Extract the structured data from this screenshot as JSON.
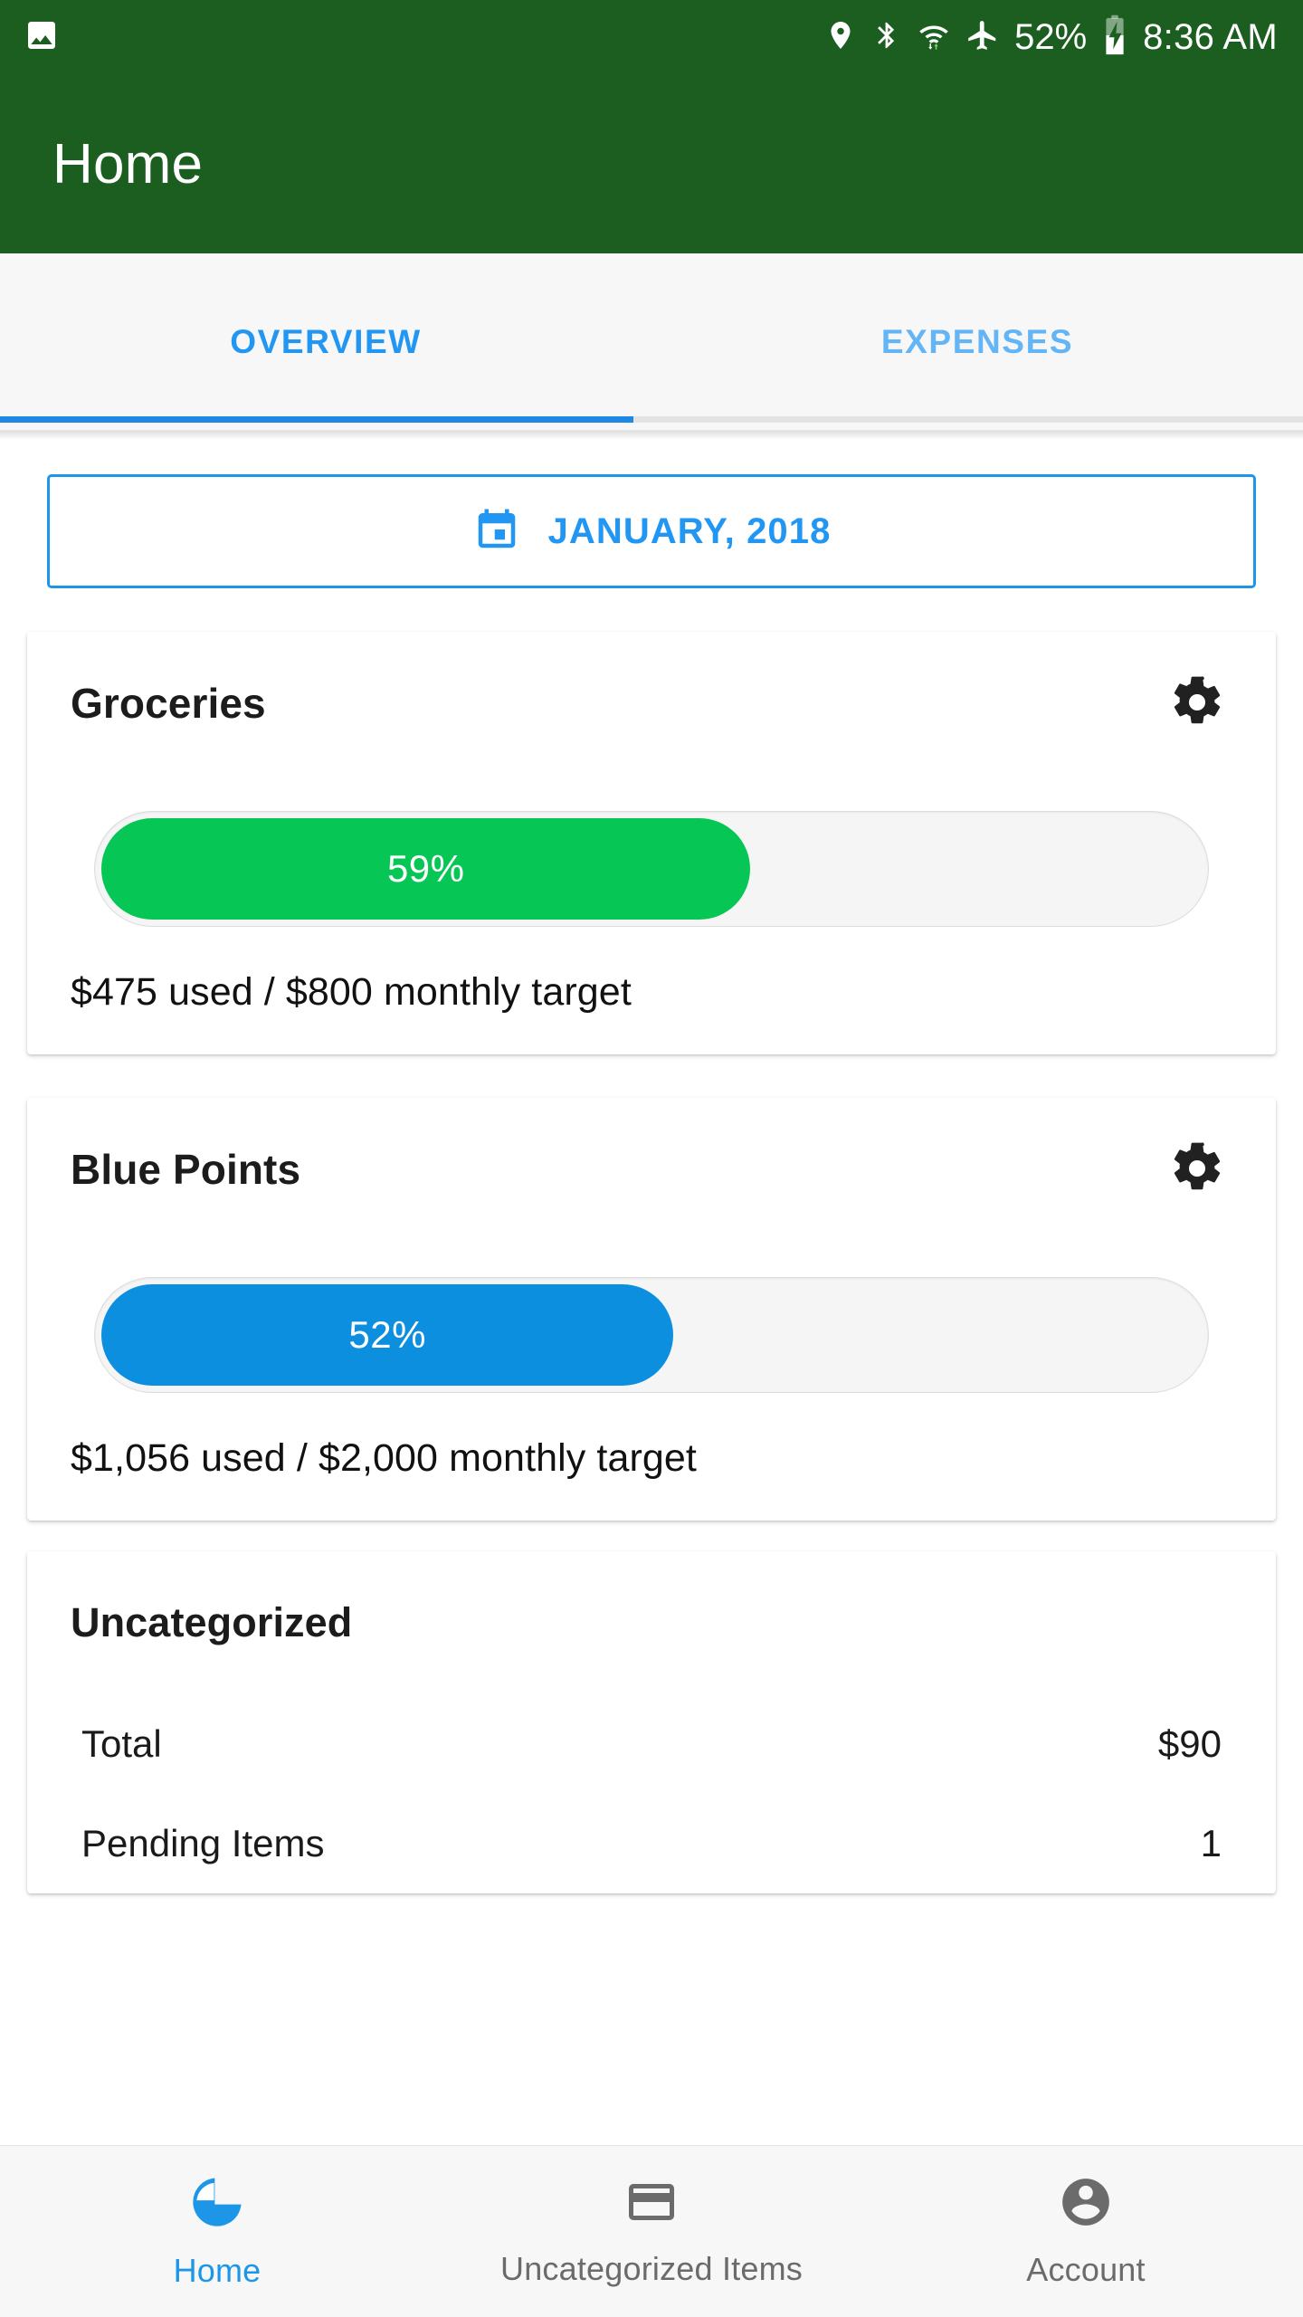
{
  "status_bar": {
    "left_icons": [
      "image-icon"
    ],
    "right_icons": [
      "location-icon",
      "bluetooth-icon",
      "wifi-icon",
      "airplane-icon"
    ],
    "battery_percent": "52%",
    "battery_icon": "battery-charging-icon",
    "time": "8:36 AM"
  },
  "app_bar": {
    "title": "Home",
    "background_color": "#1B5E20"
  },
  "tabs": {
    "active_index": 0,
    "items": [
      {
        "label": "OVERVIEW"
      },
      {
        "label": "EXPENSES"
      }
    ],
    "active_color": "#2196F3",
    "inactive_color": "#64b5f6"
  },
  "date_selector": {
    "icon": "calendar-icon",
    "label": "JANUARY, 2018",
    "color": "#2196F3"
  },
  "budget_cards": [
    {
      "title": "Groceries",
      "settings_icon": "gear-icon",
      "percent_label": "59%",
      "percent_value": 59,
      "bar_color": "#06C755",
      "caption": "$475 used / $800 monthly target",
      "used": "$475",
      "target": "$800"
    },
    {
      "title": "Blue Points",
      "settings_icon": "gear-icon",
      "percent_label": "52%",
      "percent_value": 52,
      "bar_color": "#0D8FE0",
      "caption": "$1,056 used / $2,000 monthly target",
      "used": "$1,056",
      "target": "$2,000"
    }
  ],
  "uncategorized_card": {
    "title": "Uncategorized",
    "rows": [
      {
        "key": "Total",
        "value": "$90"
      },
      {
        "key": "Pending Items",
        "value": "1"
      }
    ]
  },
  "bottom_nav": {
    "active_index": 0,
    "items": [
      {
        "label": "Home",
        "icon": "pie-chart-icon"
      },
      {
        "label": "Uncategorized Items",
        "icon": "credit-card-icon"
      },
      {
        "label": "Account",
        "icon": "account-circle-icon"
      }
    ],
    "active_color": "#1E96E8",
    "inactive_color": "#6b6b6b"
  }
}
